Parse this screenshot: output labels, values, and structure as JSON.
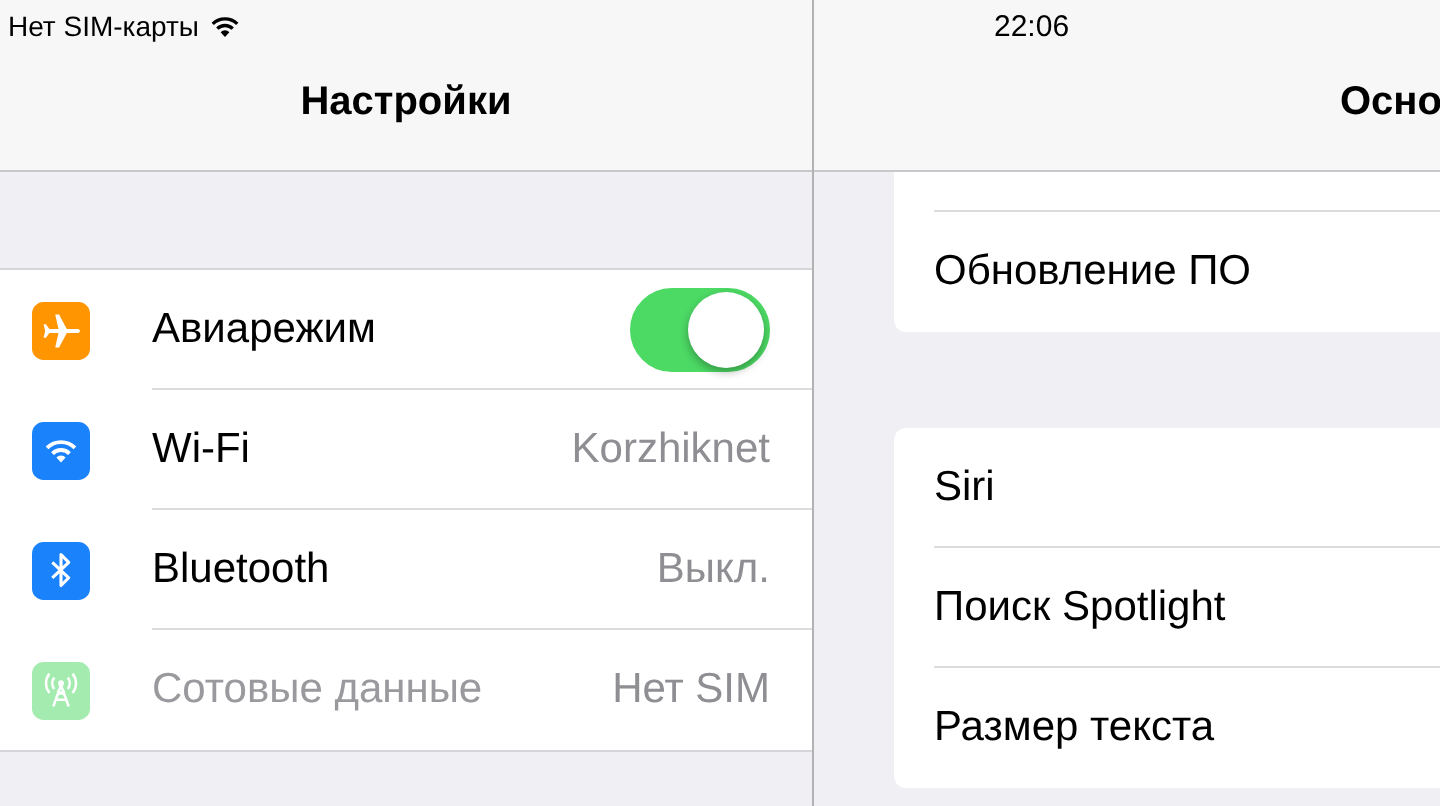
{
  "status_bar": {
    "carrier": "Нет SIM-карты",
    "time": "22:06"
  },
  "master": {
    "title": "Настройки",
    "rows": [
      {
        "label": "Авиарежим",
        "kind": "toggle",
        "on": true,
        "disabled": false
      },
      {
        "label": "Wi-Fi",
        "kind": "value",
        "value": "Korzhiknet",
        "disabled": false
      },
      {
        "label": "Bluetooth",
        "kind": "value",
        "value": "Выкл.",
        "disabled": false
      },
      {
        "label": "Сотовые данные",
        "kind": "value",
        "value": "Нет SIM",
        "disabled": true
      }
    ]
  },
  "detail": {
    "title": "Осно",
    "groups": [
      {
        "rows": [
          {
            "label": ""
          },
          {
            "label": "Обновление ПО"
          }
        ]
      },
      {
        "rows": [
          {
            "label": "Siri"
          },
          {
            "label": "Поиск Spotlight"
          },
          {
            "label": "Размер текста"
          }
        ]
      }
    ]
  }
}
